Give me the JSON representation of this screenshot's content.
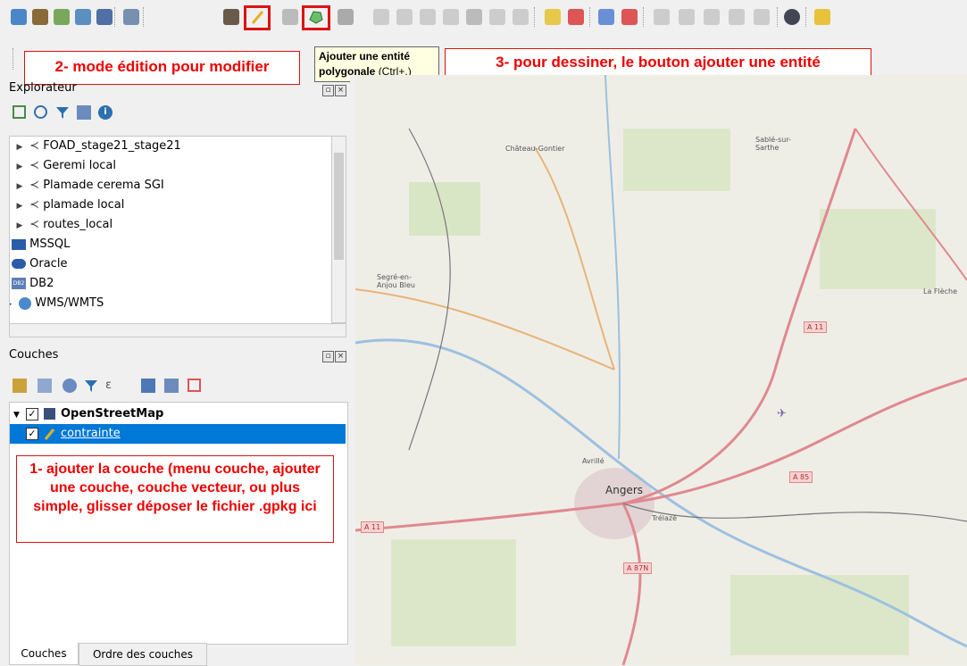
{
  "toolbar": {
    "tooltip_title": "Ajouter une entité",
    "tooltip_body": "polygonale",
    "tooltip_shortcut": "(Ctrl+.)"
  },
  "callouts": {
    "edit_mode": "2- mode édition pour modifier",
    "draw": "3- pour dessiner, le bouton ajouter une entité",
    "add_layer": "1- ajouter la couche (menu couche, ajouter une couche, couche vecteur, ou plus simple, glisser déposer le fichier .gpkg ici"
  },
  "browser": {
    "title": "Explorateur",
    "items": [
      {
        "label": "FOAD_stage21_stage21",
        "icon": "postgis-icon"
      },
      {
        "label": "Geremi local",
        "icon": "postgis-icon"
      },
      {
        "label": "Plamade cerema SGI",
        "icon": "postgis-icon"
      },
      {
        "label": "plamade local",
        "icon": "postgis-icon"
      },
      {
        "label": "routes_local",
        "icon": "postgis-icon"
      },
      {
        "label": "MSSQL",
        "icon": "mssql-icon"
      },
      {
        "label": "Oracle",
        "icon": "oracle-icon"
      },
      {
        "label": "DB2",
        "icon": "db2-icon"
      },
      {
        "label": "WMS/WMTS",
        "icon": "globe-icon"
      }
    ],
    "db2_badge": "DB2"
  },
  "layers": {
    "title": "Couches",
    "items": [
      {
        "label": "OpenStreetMap",
        "checked": true
      },
      {
        "label": "contrainte",
        "checked": true,
        "selected": true
      }
    ]
  },
  "tabs": [
    "Couches",
    "Ordre des couches"
  ],
  "map": {
    "labels": [
      "Château-Gontier",
      "Sablé-sur-Sarthe",
      "Segré-en-Anjou Bleu",
      "La Flèche",
      "Avrillé",
      "Angers",
      "Trélazé"
    ],
    "shields": [
      "A 11",
      "A 85",
      "A 11",
      "A 87N"
    ]
  },
  "colors": {
    "accent": "#d11111",
    "callout_text": "#e00000",
    "selection": "#0078d7"
  }
}
